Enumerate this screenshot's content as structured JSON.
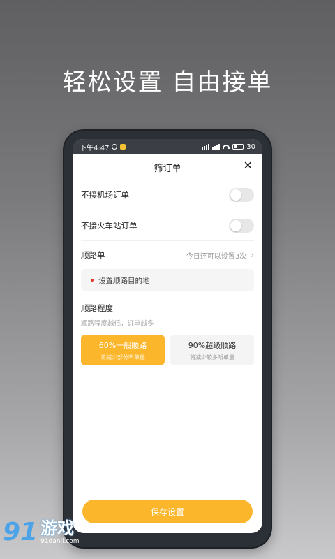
{
  "headline": "轻松设置 自由接单",
  "status_bar": {
    "time": "下午4:47",
    "battery": "30"
  },
  "sheet": {
    "title": "筛订单",
    "close_glyph": "✕"
  },
  "filters": [
    {
      "label": "不接机场订单",
      "enabled": false
    },
    {
      "label": "不接火车站订单",
      "enabled": false
    }
  ],
  "route": {
    "label": "顺路单",
    "hint": "今日还可以设置3次",
    "destination_placeholder": "设置顺路目的地"
  },
  "route_level": {
    "title": "顺路程度",
    "subtitle": "顺路程度越低，订单越多",
    "options": [
      {
        "title": "60%一般顺路",
        "subtitle": "将减少部分听单量",
        "selected": true
      },
      {
        "title": "90%超级顺路",
        "subtitle": "将减少较多听单量",
        "selected": false
      }
    ]
  },
  "save_label": "保存设置",
  "watermark": {
    "logo_number": "91",
    "name": "游戏",
    "url": "91danji.com"
  },
  "colors": {
    "accent": "#fbb62b",
    "destination_dot": "#e0352b"
  }
}
